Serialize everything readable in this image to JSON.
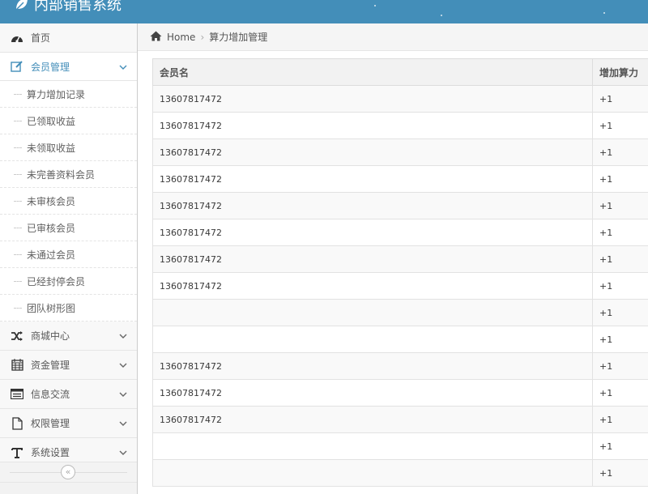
{
  "app": {
    "title": "内部销售系统",
    "accent_color": "#438eb9"
  },
  "sidebar": {
    "items": [
      {
        "label": "首页",
        "icon": "dashboard-icon"
      },
      {
        "label": "会员管理",
        "icon": "edit-icon",
        "open": true
      },
      {
        "label": "商城中心",
        "icon": "shuffle-icon"
      },
      {
        "label": "资金管理",
        "icon": "calendar-icon"
      },
      {
        "label": "信息交流",
        "icon": "list-icon"
      },
      {
        "label": "权限管理",
        "icon": "file-icon"
      },
      {
        "label": "系统设置",
        "icon": "text-icon"
      }
    ],
    "submenu": [
      "算力增加记录",
      "已领取收益",
      "未领取收益",
      "未完善资料会员",
      "未审核会员",
      "已审核会员",
      "未通过会员",
      "已经封停会员",
      "团队树形图"
    ],
    "collapse_icon": "«"
  },
  "breadcrumb": {
    "home": "Home",
    "current": "算力增加管理"
  },
  "table": {
    "headers": [
      "会员名",
      "增加算力"
    ],
    "rows": [
      [
        "13607817472",
        "+1"
      ],
      [
        "13607817472",
        "+1"
      ],
      [
        "13607817472",
        "+1"
      ],
      [
        "13607817472",
        "+1"
      ],
      [
        "13607817472",
        "+1"
      ],
      [
        "13607817472",
        "+1"
      ],
      [
        "13607817472",
        "+1"
      ],
      [
        "13607817472",
        "+1"
      ],
      [
        "",
        "+1"
      ],
      [
        "",
        "+1"
      ],
      [
        "13607817472",
        "+1"
      ],
      [
        "13607817472",
        "+1"
      ],
      [
        "13607817472",
        "+1"
      ],
      [
        "",
        "+1"
      ],
      [
        "",
        "+1"
      ]
    ]
  }
}
